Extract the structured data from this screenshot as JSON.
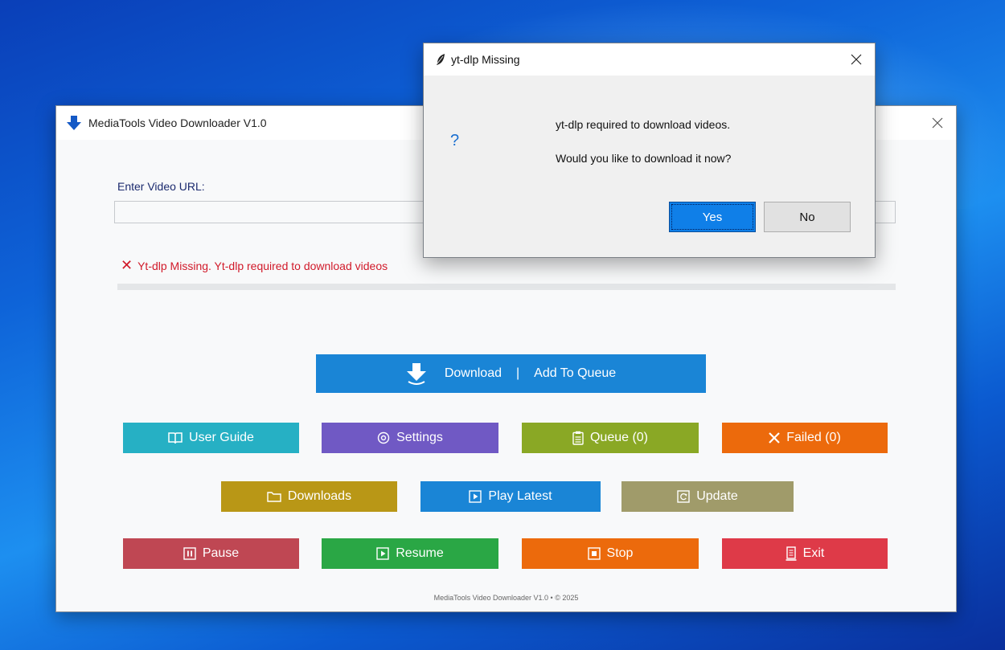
{
  "main_window": {
    "title": "MediaTools Video Downloader V1.0",
    "url_label": "Enter Video URL:",
    "url_value": "",
    "status_text": "Yt-dlp Missing. Yt-dlp required to download videos",
    "status_icon": "✕",
    "progress_percent": 0,
    "download_button": {
      "left": "Download",
      "separator": "|",
      "right": "Add To Queue"
    },
    "buttons_row1": [
      {
        "label": "User Guide",
        "color": "#26b0c4"
      },
      {
        "label": "Settings",
        "color": "#7059c4"
      },
      {
        "label": "Queue (0)",
        "color": "#8aa825"
      },
      {
        "label": "Failed (0)",
        "color": "#ec6a0c"
      }
    ],
    "buttons_row2": [
      {
        "label": "Downloads",
        "color": "#b99716"
      },
      {
        "label": "Play Latest",
        "color": "#1a85d6"
      },
      {
        "label": "Update",
        "color": "#a09b6a"
      }
    ],
    "buttons_row3": [
      {
        "label": "Pause",
        "color": "#bf4753"
      },
      {
        "label": "Resume",
        "color": "#2aa745"
      },
      {
        "label": "Stop",
        "color": "#ec6a0c"
      },
      {
        "label": "Exit",
        "color": "#de3a48"
      }
    ],
    "footer": "MediaTools Video Downloader V1.0 • © 2025"
  },
  "dialog": {
    "title": "yt-dlp Missing",
    "question_icon": "?",
    "message_line1": "yt-dlp required to download videos.",
    "message_line2": "Would you like to download it now?",
    "yes_label": "Yes",
    "no_label": "No"
  },
  "colors": {
    "accent_blue": "#1a85d6",
    "error_red": "#d11a2a"
  }
}
